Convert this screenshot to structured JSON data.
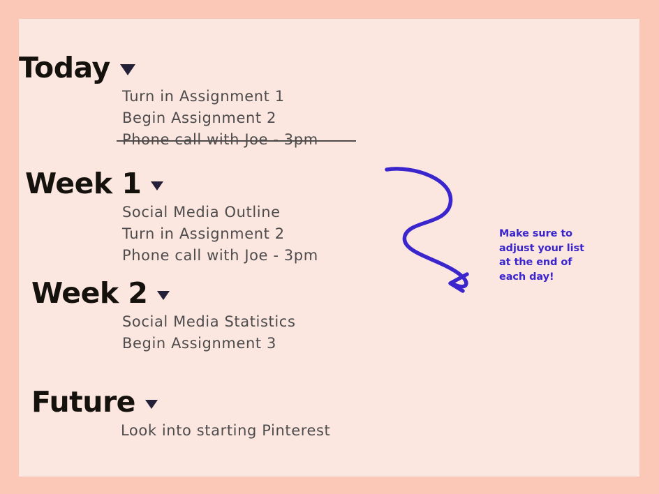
{
  "board": {
    "frame_color": "#fbc7b6",
    "panel_color": "#fce7e0",
    "heading_color": "#15120e",
    "item_color": "#4d4b4c",
    "caret_color": "#242038",
    "accent_color": "#3a26cc"
  },
  "sections": [
    {
      "title": "Today",
      "caret": "chevron-down-icon",
      "items": [
        {
          "text": "Turn in Assignment 1",
          "done": false
        },
        {
          "text": "Begin Assignment 2",
          "done": false
        },
        {
          "text": "Phone call with Joe - 3pm",
          "done": true
        }
      ]
    },
    {
      "title": "Week 1",
      "caret": "chevron-down-icon",
      "items": [
        {
          "text": "Social Media Outline",
          "done": false
        },
        {
          "text": "Turn in Assignment 2",
          "done": false
        },
        {
          "text": "Phone call with Joe - 3pm",
          "done": false
        }
      ]
    },
    {
      "title": "Week 2",
      "caret": "chevron-down-icon",
      "items": [
        {
          "text": "Social Media Statistics",
          "done": false
        },
        {
          "text": "Begin Assignment 3",
          "done": false
        }
      ]
    },
    {
      "title": "Future",
      "caret": "chevron-down-icon",
      "items": [
        {
          "text": "Look into starting Pinterest",
          "done": false
        }
      ]
    }
  ],
  "annotation": {
    "text": "Make sure to adjust your list at the end of each day!",
    "arrow": "curved-arrow-icon",
    "color": "#3a26cc"
  }
}
